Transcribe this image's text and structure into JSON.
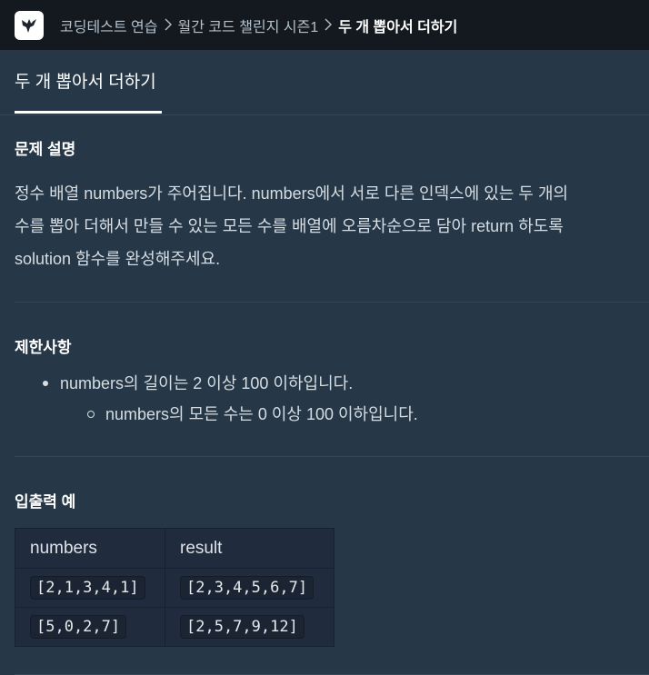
{
  "breadcrumb": {
    "items": [
      "코딩테스트 연습",
      "월간 코드 챌린지 시즌1"
    ],
    "current": "두 개 뽑아서 더하기"
  },
  "tab": {
    "label": "두 개 뽑아서 더하기"
  },
  "description": {
    "title": "문제 설명",
    "lines": [
      "정수 배열 numbers가 주어집니다. numbers에서 서로 다른 인덱스에 있는 두 개의",
      "수를 뽑아 더해서 만들 수 있는 모든 수를 배열에 오름차순으로 담아 return 하도록",
      "solution 함수를 완성해주세요."
    ]
  },
  "constraints": {
    "title": "제한사항",
    "items": [
      "numbers의 길이는 2 이상 100 이하입니다.",
      "numbers의 모든 수는 0 이상 100 이하입니다."
    ]
  },
  "examples": {
    "title": "입출력 예",
    "headers": [
      "numbers",
      "result"
    ],
    "rows": [
      [
        "[2,1,3,4,1]",
        "[2,3,4,5,6,7]"
      ],
      [
        "[5,0,2,7]",
        "[2,5,7,9,12]"
      ]
    ]
  },
  "colors": {
    "background": "#263747",
    "topbar": "#14191f",
    "table": "#202b3d"
  }
}
